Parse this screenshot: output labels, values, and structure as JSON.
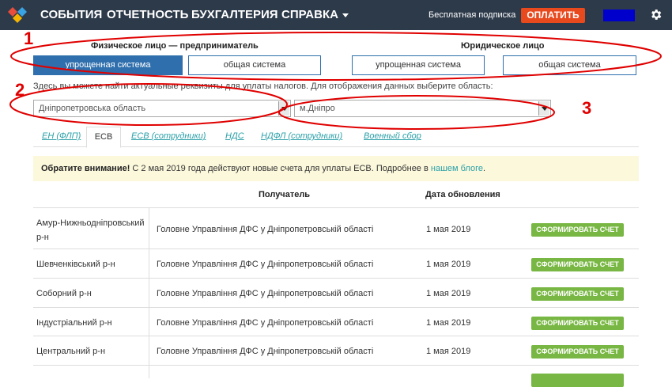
{
  "nav": {
    "items": [
      "СОБЫТИЯ",
      "ОТЧЕТНОСТЬ",
      "БУХГАЛТЕРИЯ",
      "СПРАВКА"
    ],
    "subscription": "Бесплатная подписка",
    "pay": "ОПЛАТИТЬ"
  },
  "taxpayer": {
    "individual_title": "Физическое лицо — предприниматель",
    "legal_title": "Юридическое лицо",
    "buttons": [
      "упрощенная система",
      "общая система",
      "упрощенная система",
      "общая система"
    ]
  },
  "hint": "Здесь вы можете найти актуальные реквизиты для уплаты налогов. Для отображения данных выберите область:",
  "region_select": {
    "value": "Дніпропетровська область"
  },
  "city_select": {
    "value": "м.Дніпро"
  },
  "tabs": [
    "ЕН (ФЛП)",
    "ЕСВ",
    "ЕСВ (сотрудники)",
    "НДС",
    "НДФЛ (сотрудники)",
    "Военный сбор"
  ],
  "notice": {
    "bold": "Обратите внимание!",
    "text": " С 2 мая 2019 года действуют новые счета для уплаты ЕСВ. Подробнее в ",
    "link": "нашем блоге",
    "end": "."
  },
  "table": {
    "headers": [
      "Получатель",
      "Дата обновления"
    ],
    "rows": [
      {
        "district": "Амур-Нижньодніпровський р-н",
        "recipient": "Головне Управління ДФС у Дніпропетровській області",
        "date": "1 мая 2019",
        "action": "СФОРМИРОВАТЬ СЧЕТ"
      },
      {
        "district": "Шевченківський р-н",
        "recipient": "Головне Управління ДФС у Дніпропетровській області",
        "date": "1 мая 2019",
        "action": "СФОРМИРОВАТЬ СЧЕТ"
      },
      {
        "district": "Соборний р-н",
        "recipient": "Головне Управління ДФС у Дніпропетровській області",
        "date": "1 мая 2019",
        "action": "СФОРМИРОВАТЬ СЧЕТ"
      },
      {
        "district": "Індустріальний р-н",
        "recipient": "Головне Управління ДФС у Дніпропетровській області",
        "date": "1 мая 2019",
        "action": "СФОРМИРОВАТЬ СЧЕТ"
      },
      {
        "district": "Центральний р-н",
        "recipient": "Головне Управління ДФС у Дніпропетровській області",
        "date": "1 мая 2019",
        "action": "СФОРМИРОВАТЬ СЧЕТ"
      }
    ]
  },
  "annotations": [
    "1",
    "2",
    "3"
  ],
  "colors": {
    "header_bg": "#2d3a4a",
    "accent_blue": "#2f6fad",
    "pay": "#e8491d",
    "generate": "#78b743",
    "annotation": "#e00000"
  }
}
